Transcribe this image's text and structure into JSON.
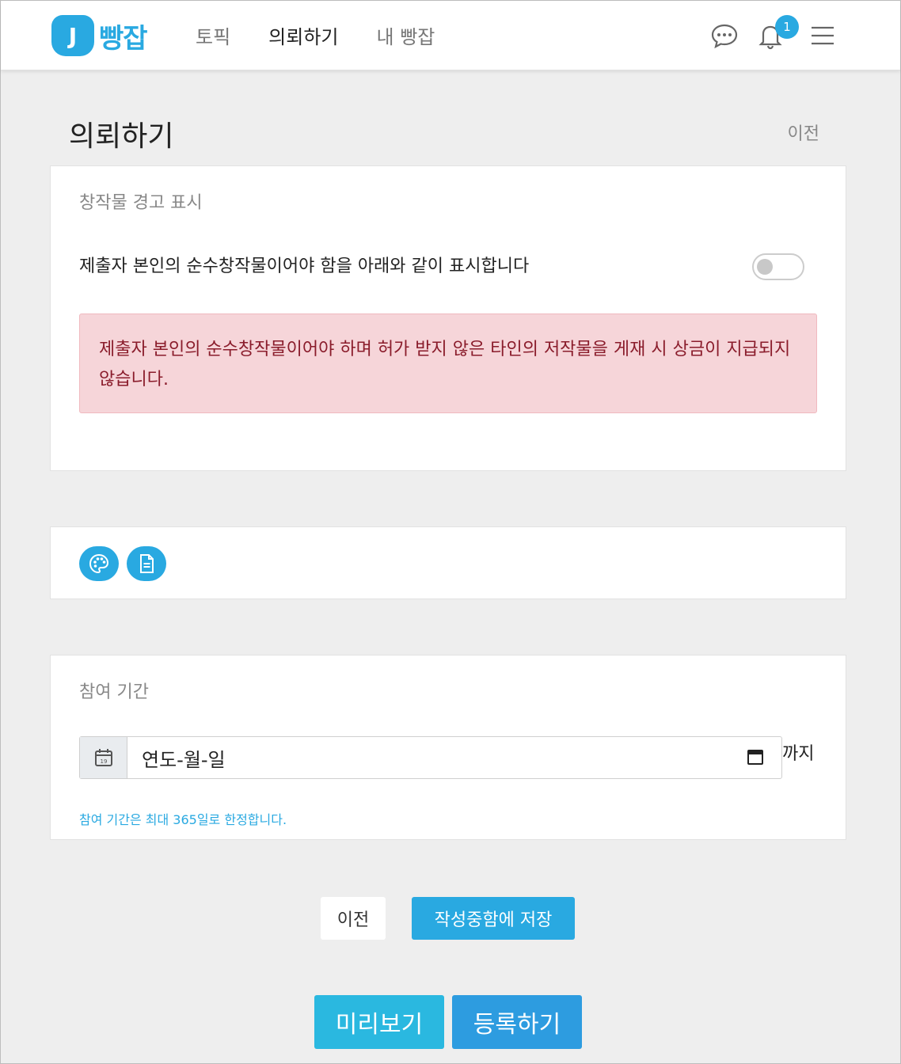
{
  "header": {
    "logo_mark": "J",
    "logo_text": "빵잡",
    "nav": [
      {
        "label": "토픽"
      },
      {
        "label": "의뢰하기"
      },
      {
        "label": "내 빵잡"
      }
    ],
    "notification_count": "1",
    "icons": [
      "chat-icon",
      "bell-icon",
      "menu-icon"
    ]
  },
  "page": {
    "title": "의뢰하기",
    "prev_link": "이전"
  },
  "warning_card": {
    "label": "창작물 경고 표시",
    "description": "제출자 본인의 순수창작물이어야 함을 아래와 같이 표시합니다",
    "toggle_on": false,
    "alert": "제출자 본인의 순수창작물이어야 하며 허가 받지 않은 타인의 저작물을 게재 시 상금이 지급되지 않습니다."
  },
  "tools_card": {
    "buttons": [
      "palette-icon",
      "document-icon"
    ]
  },
  "period_card": {
    "label": "참여 기간",
    "date_placeholder": "연도-월-일",
    "calendar_badge": "19",
    "until": "까지",
    "hint": "참여 기간은 최대 365일로 한정합니다."
  },
  "actions": {
    "prev": "이전",
    "save": "작성중함에 저장",
    "preview": "미리보기",
    "register": "등록하기"
  },
  "colors": {
    "accent": "#29a9e1",
    "alert_bg": "#f6d5d9",
    "alert_text": "#8a1c2b"
  }
}
